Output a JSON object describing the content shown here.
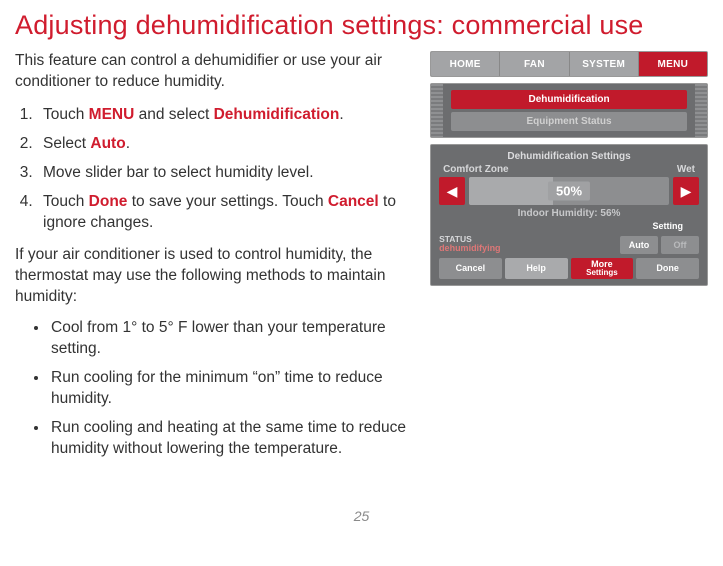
{
  "title": "Adjusting dehumidification settings: commercial use",
  "intro": "This feature can control a dehumidifier or use your air conditioner to reduce humidity.",
  "steps": [
    {
      "pre": "Touch ",
      "kw1": "MENU",
      "mid": " and select ",
      "kw2": "Dehumidification",
      "post": "."
    },
    {
      "pre": "Select ",
      "kw1": "Auto",
      "post": "."
    },
    {
      "plain": "Move slider bar to select humidity level."
    },
    {
      "pre": "Touch ",
      "kw1": "Done",
      "mid": " to save your settings. Touch ",
      "kw2": "Cancel",
      "post": " to ignore changes."
    }
  ],
  "sub_intro": "If your air conditioner is used to control humidity, the thermostat may use the following methods to maintain humidity:",
  "bullets": [
    "Cool from 1° to 5° F lower than your temperature setting.",
    "Run cooling for the minimum “on” time to reduce humidity.",
    "Run cooling and heating at the same time to reduce humidity without lowering the temperature."
  ],
  "page_number": "25",
  "tabs": {
    "home": "HOME",
    "fan": "FAN",
    "system": "SYSTEM",
    "menu": "MENU"
  },
  "menu": {
    "selected": "Dehumidification",
    "next": "Equipment Status"
  },
  "settings": {
    "title": "Dehumidification Settings",
    "range_left": "Comfort Zone",
    "range_right": "Wet",
    "value": "50%",
    "indoor": "Indoor Humidity: 56%",
    "status_label": "STATUS",
    "status_value": "dehumidifying",
    "setting_label": "Setting",
    "auto": "Auto",
    "off": "Off",
    "cancel": "Cancel",
    "help": "Help",
    "more1": "More",
    "more2": "Settings",
    "done": "Done"
  }
}
